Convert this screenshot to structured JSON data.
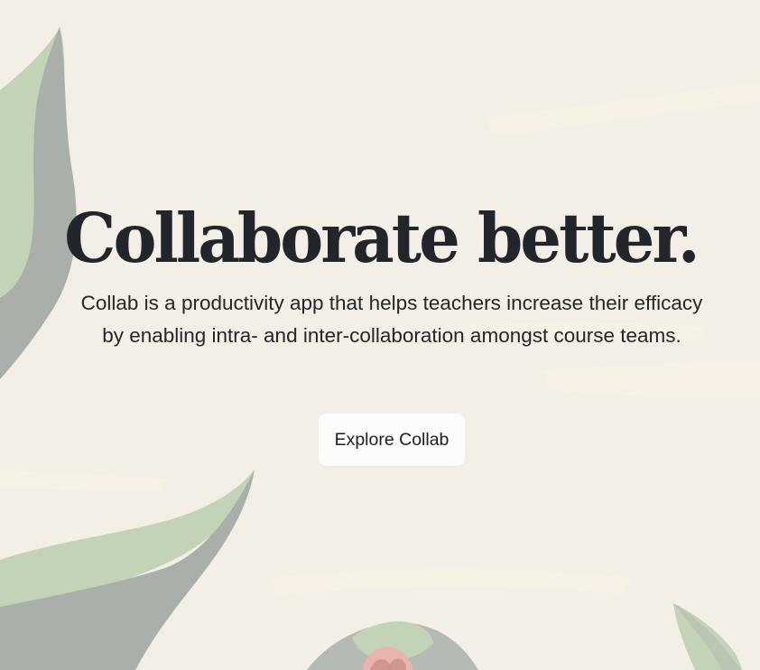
{
  "hero": {
    "headline": "Collaborate better.",
    "description": "Collab is a productivity app that helps teachers increase their efficacy by enabling intra- and inter-collaboration amongst course teams.",
    "cta_label": "Explore Collab"
  },
  "colors": {
    "background": "#f3eee6",
    "leaf_light_green": "#c3d3b8",
    "leaf_grey_green": "#a9b0aa",
    "flower_pink": "#e9b4ad",
    "text_dark": "#22252a",
    "button_background": "#fdfcfa"
  },
  "decorations": [
    "leaf-illustration",
    "flower-illustration",
    "brush-stroke"
  ]
}
